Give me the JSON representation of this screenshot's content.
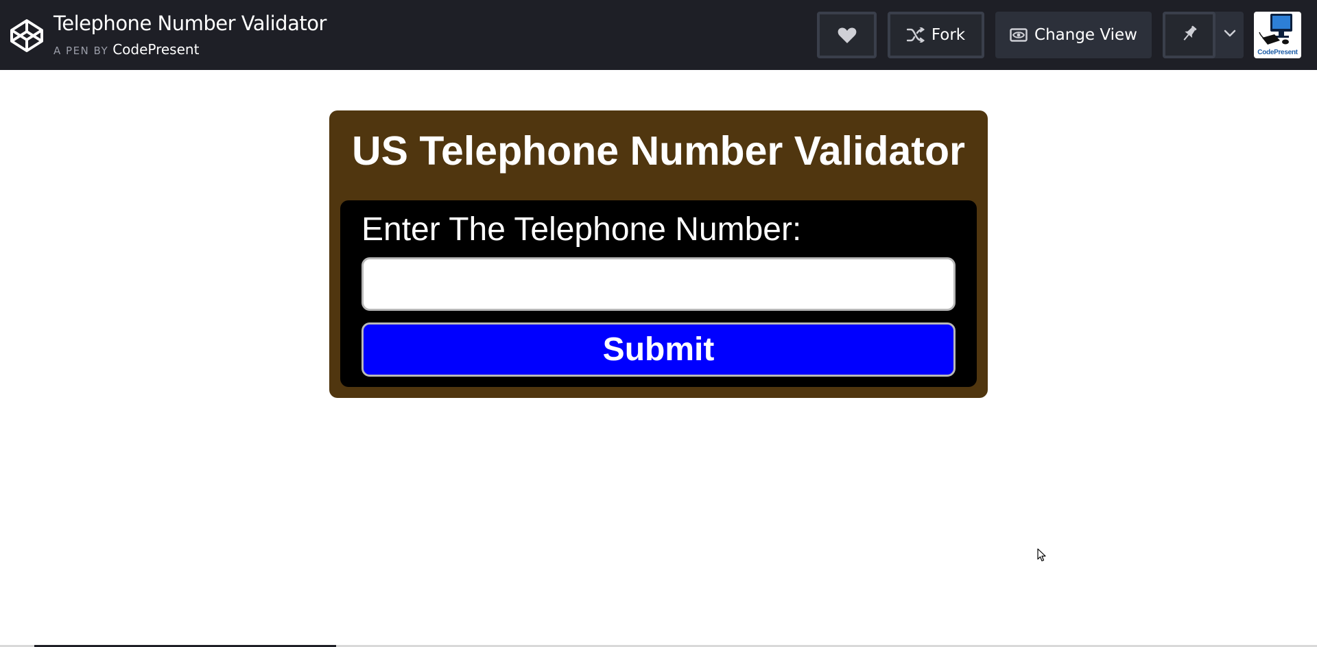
{
  "header": {
    "title": "Telephone Number Validator",
    "byline_prefix": "A PEN BY",
    "author": "CodePresent",
    "buttons": {
      "like_icon": "heart-icon",
      "fork_label": "Fork",
      "fork_icon": "fork-icon",
      "change_view_label": "Change View",
      "change_view_icon": "eye-icon",
      "pin_icon": "pin-icon",
      "more_icon": "chevron-down-icon"
    },
    "avatar_caption": "CodePresent"
  },
  "app": {
    "heading": "US Telephone Number Validator",
    "input_label": "Enter The Telephone Number:",
    "input_value": "",
    "submit_label": "Submit"
  },
  "colors": {
    "header_bg": "#1e1f26",
    "card_bg": "#50360f",
    "panel_bg": "#000000",
    "submit_bg": "#0000ff"
  }
}
